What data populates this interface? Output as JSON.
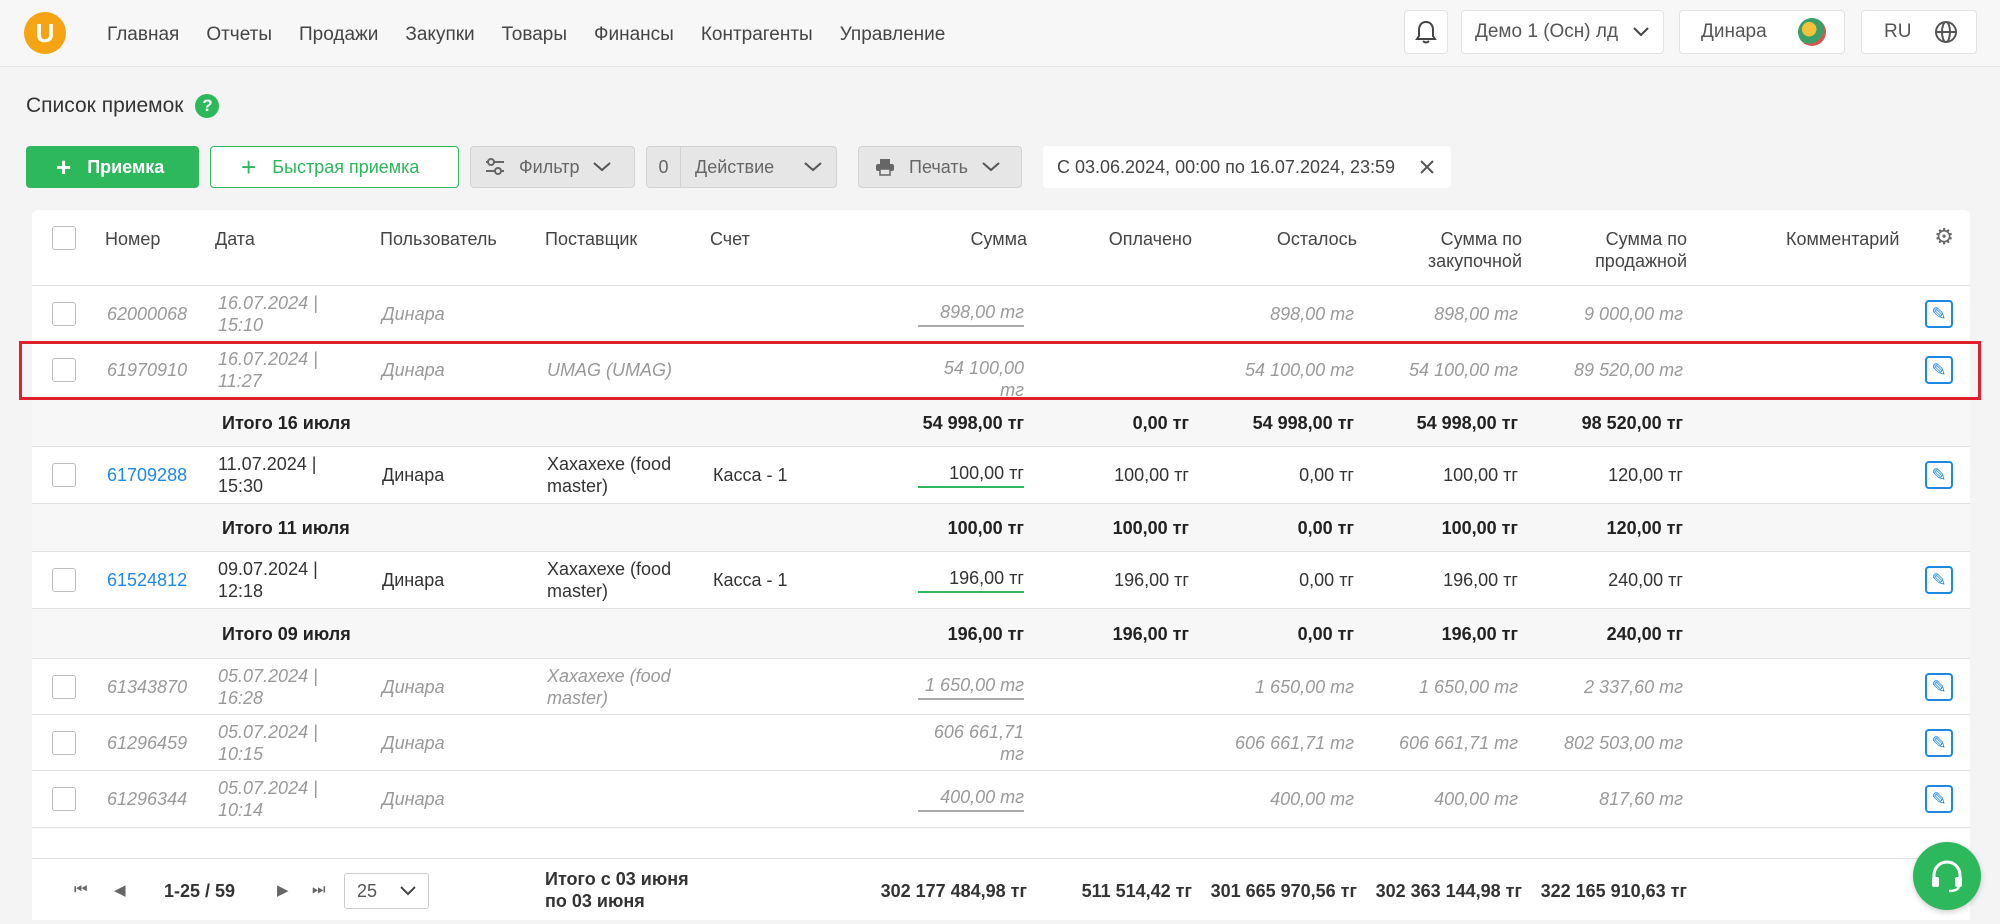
{
  "logo": "U",
  "nav": [
    "Главная",
    "Отчеты",
    "Продажи",
    "Закупки",
    "Товары",
    "Финансы",
    "Контрагенты",
    "Управление"
  ],
  "header": {
    "company": "Демо 1 (Осн) лд",
    "user": "Динара",
    "lang": "RU"
  },
  "page": {
    "title": "Список приемок",
    "help": "?"
  },
  "toolbar": {
    "add": "Приемка",
    "quick_add": "Быстрая приемка",
    "filter": "Фильтр",
    "action_count": "0",
    "action": "Действие",
    "print": "Печать",
    "date_range": "С 03.06.2024, 00:00 по 16.07.2024, 23:59"
  },
  "columns": {
    "number": "Номер",
    "date": "Дата",
    "user": "Пользователь",
    "supplier": "Поставщик",
    "account": "Счет",
    "sum": "Сумма",
    "paid": "Оплачено",
    "left": "Осталось",
    "purchase_sum_1": "Сумма по",
    "purchase_sum_2": "закупочной",
    "sale_sum_1": "Сумма по",
    "sale_sum_2": "продажной",
    "comment": "Комментарий"
  },
  "rows": [
    {
      "type": "draft",
      "number": "62000068",
      "date1": "16.07.2024 |",
      "date2": "15:10",
      "user": "Динара",
      "supplier1": "",
      "supplier2": "",
      "account": "",
      "sum": "898,00 тг",
      "sum2": "",
      "paid": "",
      "left": "898,00 тг",
      "purchase": "898,00 тг",
      "sale": "9 000,00 тг"
    },
    {
      "type": "draft",
      "number": "61970910",
      "date1": "16.07.2024 |",
      "date2": "11:27",
      "user": "Динара",
      "supplier1": "UMAG (UMAG)",
      "supplier2": "",
      "account": "",
      "sum": "54 100,00 тг",
      "sum2": "",
      "paid": "",
      "left": "54 100,00 тг",
      "purchase": "54 100,00 тг",
      "sale": "89 520,00 тг"
    },
    {
      "type": "subtotal",
      "label": "Итого 16 июля",
      "sum": "54 998,00 тг",
      "paid": "0,00 тг",
      "left": "54 998,00 тг",
      "purchase": "54 998,00 тг",
      "sale": "98 520,00 тг"
    },
    {
      "type": "normal",
      "number": "61709288",
      "date1": "11.07.2024 |",
      "date2": "15:30",
      "user": "Динара",
      "supplier1": "Хахахехе (food",
      "supplier2": "master)",
      "account": "Касса - 1",
      "sum": "100,00 тг",
      "sum2": "",
      "paid": "100,00 тг",
      "left": "0,00 тг",
      "purchase": "100,00 тг",
      "sale": "120,00 тг"
    },
    {
      "type": "subtotal",
      "label": "Итого 11 июля",
      "sum": "100,00 тг",
      "paid": "100,00 тг",
      "left": "0,00 тг",
      "purchase": "100,00 тг",
      "sale": "120,00 тг"
    },
    {
      "type": "normal",
      "number": "61524812",
      "date1": "09.07.2024 |",
      "date2": "12:18",
      "user": "Динара",
      "supplier1": "Хахахехе (food",
      "supplier2": "master)",
      "account": "Касса - 1",
      "sum": "196,00 тг",
      "sum2": "",
      "paid": "196,00 тг",
      "left": "0,00 тг",
      "purchase": "196,00 тг",
      "sale": "240,00 тг"
    },
    {
      "type": "subtotal",
      "label": "Итого 09 июля",
      "sum": "196,00 тг",
      "paid": "196,00 тг",
      "left": "0,00 тг",
      "purchase": "196,00 тг",
      "sale": "240,00 тг"
    },
    {
      "type": "draft",
      "number": "61343870",
      "date1": "05.07.2024 |",
      "date2": "16:28",
      "user": "Динара",
      "supplier1": "Хахахехе (food",
      "supplier2": "master)",
      "account": "",
      "sum": "1 650,00 тг",
      "sum2": "",
      "paid": "",
      "left": "1 650,00 тг",
      "purchase": "1 650,00 тг",
      "sale": "2 337,60 тг"
    },
    {
      "type": "draft",
      "number": "61296459",
      "date1": "05.07.2024 |",
      "date2": "10:15",
      "user": "Динара",
      "supplier1": "",
      "supplier2": "",
      "account": "",
      "sum": "606 661,71",
      "sum2": "тг",
      "paid": "",
      "left": "606 661,71 тг",
      "purchase": "606 661,71 тг",
      "sale": "802 503,00 тг"
    },
    {
      "type": "draft",
      "number": "61296344",
      "date1": "05.07.2024 |",
      "date2": "10:14",
      "user": "Динара",
      "supplier1": "",
      "supplier2": "",
      "account": "",
      "sum": "400,00 тг",
      "sum2": "",
      "paid": "",
      "left": "400,00 тг",
      "purchase": "400,00 тг",
      "sale": "817,60 тг"
    }
  ],
  "footer": {
    "range": "1-25 / 59",
    "page_size": "25",
    "total_label_1": "Итого с 03 июня",
    "total_label_2": "по 03 июня",
    "sum": "302 177 484,98 тг",
    "paid": "511 514,42 тг",
    "left": "301 665 970,56 тг",
    "purchase": "302 363 144,98 тг",
    "sale": "322 165 910,63 тг"
  },
  "colors": {
    "accent": "#2db85c",
    "link": "#1e88e5",
    "highlight": "#e0202a"
  }
}
